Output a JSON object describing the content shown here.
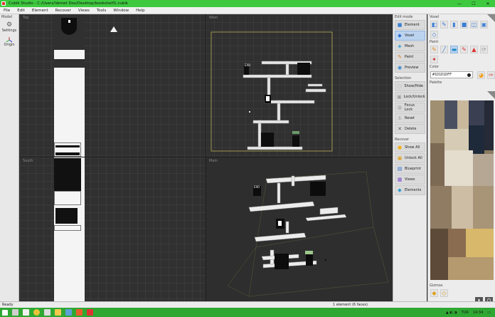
{
  "titlebar": {
    "title": "Cubik Studio - C:/Users/Vemet Dox/Desktop/bookshelf1.cubik",
    "min": "—",
    "max": "☐",
    "close": "✕"
  },
  "menu": [
    "File",
    "Edit",
    "Element",
    "Recover",
    "Views",
    "Tools",
    "Window",
    "Help"
  ],
  "left_panel": {
    "section": "Model",
    "settings": "Settings",
    "origin": "Origin"
  },
  "viewports": {
    "top": "Top",
    "west": "West",
    "south": "South",
    "main": "Main"
  },
  "shelf_labels": {
    "sign": "EXO"
  },
  "edit_mode": {
    "title": "Edit mode",
    "items": [
      "Element",
      "Voxel",
      "Mesh",
      "Paint",
      "Preview"
    ],
    "selected": "Voxel"
  },
  "selection": {
    "title": "Selection",
    "items": [
      "Show/Hide",
      "Lock/Unlock",
      "Focus Lock",
      "Reset",
      "Delete"
    ]
  },
  "recover": {
    "title": "Recover",
    "items": [
      "Show All",
      "Unlock All",
      "Blueprint",
      "Views",
      "Elements"
    ]
  },
  "voxel": {
    "title": "Voxel"
  },
  "paint": {
    "title": "Paint"
  },
  "color": {
    "title": "Color",
    "value": "#1D1D1DFF",
    "accent": "#1d1d1d"
  },
  "palette": {
    "title": "Palette"
  },
  "gizmos": {
    "title": "Gizmos"
  },
  "status": {
    "left": "Ready",
    "right": "1 element (6 faces)"
  },
  "taskbar": {
    "lang": "TUR",
    "time": "14:34"
  }
}
